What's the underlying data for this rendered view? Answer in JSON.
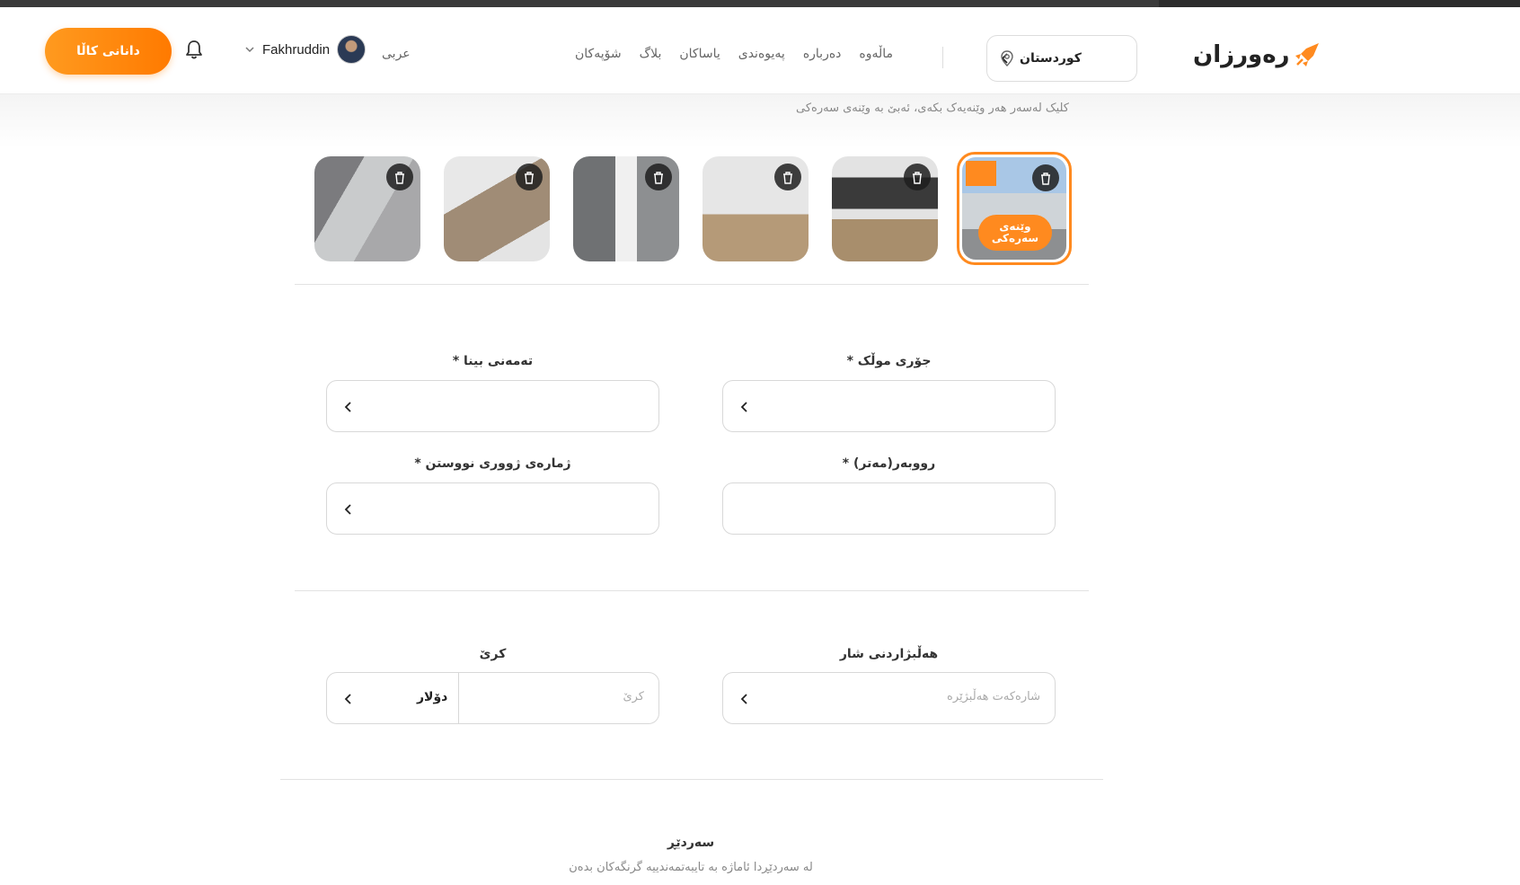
{
  "header": {
    "cta_label": "دانانی کاڵا",
    "user_name": "Fakhruddin",
    "language": "عربی",
    "nav": [
      "ماڵەوە",
      "دەربارە",
      "پەیوەندی",
      "یاساکان",
      "بلاگ",
      "شۆپەکان"
    ],
    "region": "کوردستان",
    "logo_text": "رەورزان",
    "accent_color": "#ff8a1f"
  },
  "gallery": {
    "hint": "کلیک لەسەر هەر وێنەیەک بکەی، ئەبێ بە وێنەی سەرەکی",
    "primary_tag": "وێنەی سەرەکی",
    "thumbnails": [
      "bathroom",
      "staircase",
      "toilet",
      "empty-room",
      "room-window",
      "house-exterior-primary"
    ]
  },
  "form": {
    "property_type_label": "جۆری موڵک *",
    "building_age_label": "تەمەنی بینا *",
    "area_label": "رووبەر(مەتر) *",
    "bedrooms_label": "ژمارەی ژووری نووستن *",
    "city_label": "هەڵبژاردنی شار",
    "city_placeholder": "شارەکەت هەڵبژێرە",
    "rent_label": "کرێ",
    "rent_placeholder": "کرێ",
    "currency": "دۆلار"
  },
  "section": {
    "title": "سەردێڕ",
    "subtitle": "لە سەردێڕدا ئاماژە بە تایبەتمەندییە گرنگەکان بدەن"
  }
}
